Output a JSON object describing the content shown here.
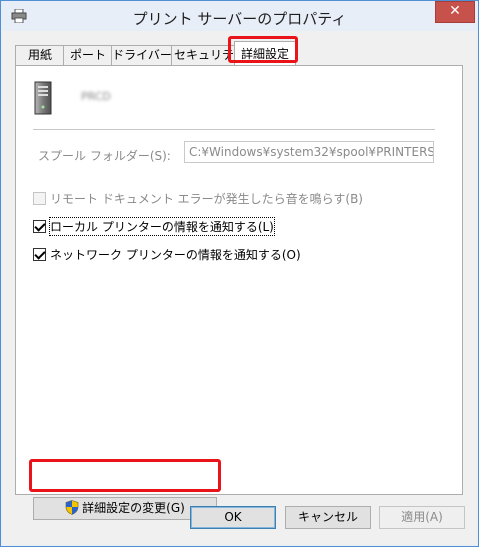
{
  "window": {
    "title": "プリント サーバーのプロパティ",
    "close_symbol": "✕"
  },
  "tabs": [
    {
      "label": "用紙"
    },
    {
      "label": "ポート"
    },
    {
      "label": "ドライバー"
    },
    {
      "label": "セキュリティ"
    },
    {
      "label": "詳細設定",
      "active": true
    }
  ],
  "advanced": {
    "server_name": "PRCD",
    "spool_label": "スプール フォルダー(S):",
    "spool_path": "C:¥Windows¥system32¥spool¥PRINTERS",
    "beep_label": "リモート ドキュメント エラーが発生したら音を鳴らす(B)",
    "beep_checked": false,
    "notify_local_label": "ローカル プリンターの情報を通知する(L)",
    "notify_local_checked": true,
    "notify_network_label": "ネットワーク プリンターの情報を通知する(O)",
    "notify_network_checked": true,
    "change_settings_label": "詳細設定の変更(G)"
  },
  "buttons": {
    "ok": "OK",
    "cancel": "キャンセル",
    "apply": "適用(A)"
  },
  "icons": {
    "title": "printer-icon",
    "server": "server-icon",
    "shield": "uac-shield-icon"
  },
  "colors": {
    "highlight": "#e8141a",
    "window_border": "#4f8fd2",
    "close_button": "#c7514b"
  }
}
